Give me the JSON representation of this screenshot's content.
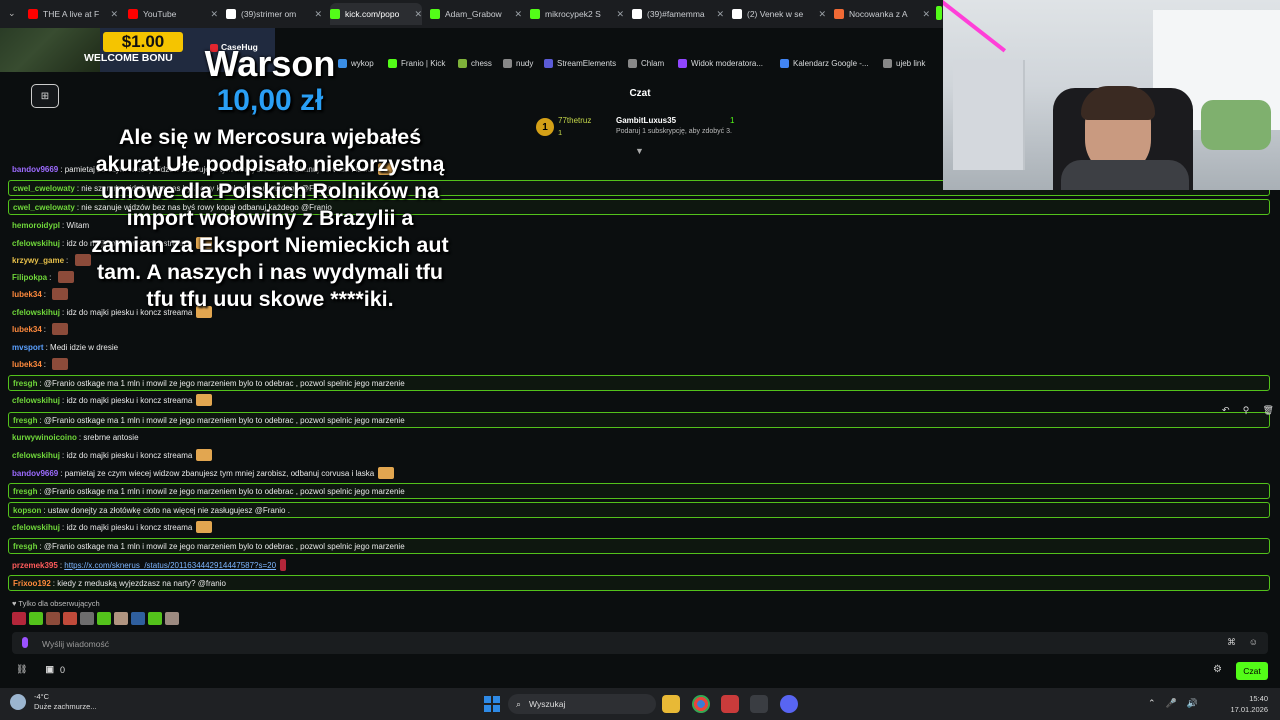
{
  "tabs": [
    {
      "label": "THE A live at F",
      "favicon": "youtube-icon",
      "color": "#ff0000"
    },
    {
      "label": "YouTube",
      "favicon": "youtube-icon",
      "color": "#ff0000"
    },
    {
      "label": "(39)strimer om",
      "favicon": "tiktok-icon",
      "color": "#ffffff"
    },
    {
      "label": "kick.com/popo",
      "favicon": "kick-icon",
      "color": "#53fc18"
    },
    {
      "label": "Adam_Grabow",
      "favicon": "kick-icon",
      "color": "#53fc18"
    },
    {
      "label": "mikrocypek2 S",
      "favicon": "kick-icon",
      "color": "#53fc18"
    },
    {
      "label": "(39)#famemma",
      "favicon": "tiktok-icon",
      "color": "#ffffff"
    },
    {
      "label": "(2) Venek w se",
      "favicon": "x-icon",
      "color": "#ffffff"
    },
    {
      "label": "Nocowanka z A",
      "favicon": "page-icon",
      "color": "#f06a35"
    }
  ],
  "bookmarks": [
    {
      "label": "wykop",
      "icon": "wykop-icon"
    },
    {
      "label": "Franio | Kick",
      "icon": "kick-icon"
    },
    {
      "label": "chess",
      "icon": "chess-icon"
    },
    {
      "label": "nudy",
      "icon": "folder-icon"
    },
    {
      "label": "StreamElements",
      "icon": "streamelements-icon"
    },
    {
      "label": "Chlam",
      "icon": "globe-icon"
    },
    {
      "label": "Widok moderatora...",
      "icon": "twitch-icon"
    },
    {
      "label": "Kalendarz Google -...",
      "icon": "calendar-icon"
    },
    {
      "label": "ujeb link",
      "icon": "globe-icon"
    }
  ],
  "promo": {
    "amount": "$1.00",
    "subtitle": "WELCOME BONU",
    "brand": "CaseHug"
  },
  "alert": {
    "name": "Warson",
    "amount": "10,00 zł",
    "message": "Ale się w Mercosura wjebałeś akurat Ułe podpisało niekorzystną umowe dla Polskich Rolników na import wołowiny z Brazylii a zamian za Eksport Niemieckich aut tam. A naszych i nas wydymali tfu tfu tfu uuu skowe ****iki."
  },
  "chat": {
    "title": "Czat",
    "pinned": {
      "user1": "77thetruz",
      "count1": "1",
      "user2": "GambitLuxus35",
      "count2": "1",
      "gift_text": "Podaruj 1 subskrypcję, aby zdobyć 3."
    },
    "messages": [
      {
        "user": "bandov9669",
        "color": "#9d6bff",
        "text": "pamietaj ze czym wiecej widzow zbanujesz tym mniej zarobisz, odbanuj corvusa i laska",
        "hl": false
      },
      {
        "user": "cwel_cwelowaty",
        "color": "#6fd63a",
        "text": "nie szanuje widzów bez nas byś rowy kopał odbanuj każdego @Franio",
        "hl": true
      },
      {
        "user": "cwel_cwelowaty",
        "color": "#6fd63a",
        "text": "nie szanuje widzów bez nas byś rowy kopał odbanuj każdego @Franio",
        "hl": true
      },
      {
        "user": "hemoroidypl",
        "color": "#6fd63a",
        "text": "Witam",
        "hl": false
      },
      {
        "user": "cfelowskihuj",
        "color": "#6fd63a",
        "text": "idz do majki piesku i koncz streama",
        "hl": false
      },
      {
        "user": "krzywy_game",
        "color": "#e7c04a",
        "text": "",
        "hl": false
      },
      {
        "user": "Filipokpa",
        "color": "#6fd63a",
        "text": "",
        "hl": false
      },
      {
        "user": "lubek34",
        "color": "#ff8a3d",
        "text": "",
        "hl": false
      },
      {
        "user": "cfelowskihuj",
        "color": "#6fd63a",
        "text": "idz do majki piesku i koncz streama",
        "hl": false
      },
      {
        "user": "lubek34",
        "color": "#ff8a3d",
        "text": "",
        "hl": false
      },
      {
        "user": "mvsport",
        "color": "#5aa0ff",
        "text": "Medi idzie w dresie",
        "hl": false
      },
      {
        "user": "lubek34",
        "color": "#ff8a3d",
        "text": "",
        "hl": false
      },
      {
        "user": "fresgh",
        "color": "#6fd63a",
        "text": "@Franio ostkage ma 1 mln i mowil ze jego marzeniem bylo to odebrac , pozwol spelnic jego marzenie",
        "hl": true
      },
      {
        "user": "cfelowskihuj",
        "color": "#6fd63a",
        "text": "idz do majki piesku i koncz streama",
        "hl": false
      },
      {
        "user": "fresgh",
        "color": "#6fd63a",
        "text": "@Franio ostkage ma 1 mln i mowil ze jego marzeniem bylo to odebrac , pozwol spelnic jego marzenie",
        "hl": true
      },
      {
        "user": "kurwywinoicoino",
        "color": "#6fd63a",
        "text": "srebrne antosie",
        "hl": false
      },
      {
        "user": "cfelowskihuj",
        "color": "#6fd63a",
        "text": "idz do majki piesku i koncz streama",
        "hl": false
      },
      {
        "user": "bandov9669",
        "color": "#9d6bff",
        "text": "pamietaj ze czym wiecej widzow zbanujesz tym mniej zarobisz, odbanuj corvusa i laska",
        "hl": false
      },
      {
        "user": "fresgh",
        "color": "#6fd63a",
        "text": "@Franio ostkage ma 1 mln i mowil ze jego marzeniem bylo to odebrac , pozwol spelnic jego marzenie",
        "hl": true
      },
      {
        "user": "kopson",
        "color": "#6fd63a",
        "text": "ustaw donejty za złotówkę cioto na więcej nie zasługujesz @Franio .",
        "hl": true
      },
      {
        "user": "cfelowskihuj",
        "color": "#6fd63a",
        "text": "idz do majki piesku i koncz streama",
        "hl": false
      },
      {
        "user": "fresgh",
        "color": "#6fd63a",
        "text": "@Franio ostkage ma 1 mln i mowil ze jego marzeniem bylo to odebrac , pozwol spelnic jego marzenie",
        "hl": true
      },
      {
        "user": "przemek395",
        "color": "#ff5b5b",
        "text": "https://x.com/sknerus_/status/2011634442914447587?s=20",
        "hl": false,
        "link": true
      },
      {
        "user": "Frixoo192",
        "color": "#ff8a3d",
        "text": "kiedy z meduską wyjezdzasz na narty? @franio",
        "hl": true
      }
    ],
    "followers_only": "Tylko dla obserwujących",
    "input_placeholder": "Wyślij wiadomość",
    "chat_button": "Czat",
    "points_count": "0"
  },
  "taskbar": {
    "temperature": "-4°C",
    "weather": "Duże zachmurze...",
    "search_placeholder": "Wyszukaj",
    "time": "15:40",
    "date": "17.01.2026"
  }
}
